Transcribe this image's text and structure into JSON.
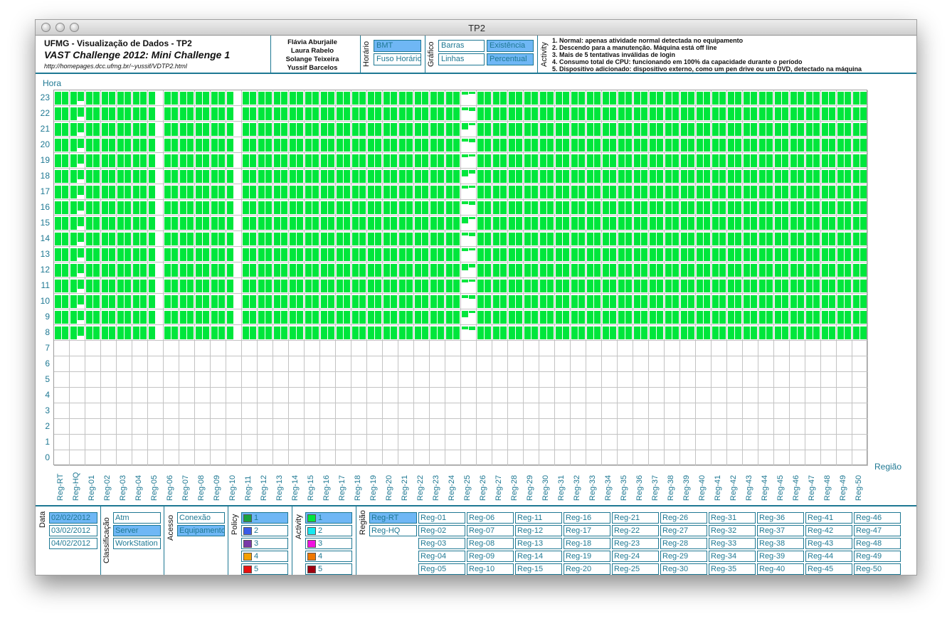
{
  "window": {
    "title": "TP2"
  },
  "header": {
    "line1": "UFMG - Visualização de Dados - TP2",
    "line2": "VAST Challenge 2012: Mini Challenge 1",
    "url": "http://homepages.dcc.ufmg.br/~yussif/VDTP2.html",
    "authors": [
      "Flávia Aburjaile",
      "Laura Rabelo",
      "Solange Teixeira",
      "Yussif Barcelos"
    ],
    "horario": {
      "label": "Horário",
      "options": [
        "BMT",
        "Fuso Horário"
      ],
      "selected": 0
    },
    "grafico": {
      "label": "Gráfico",
      "options": [
        "Barras",
        "Existência",
        "Linhas",
        "Percentual"
      ],
      "selected": [
        1,
        3
      ]
    },
    "activity_legend": {
      "label": "Activity",
      "lines": [
        "1. Normal: apenas atividade normal detectada no equipamento",
        "2. Descendo para a manutenção. Máquina está off line",
        "3. Mais de 5 tentativas inválidas de login",
        "4. Consumo total de CPU: funcionando em 100% da capacidade durante o período",
        "5. Dispositivo adicionado: dispositivo externo, como um pen drive ou um DVD, detectado na máquina"
      ]
    }
  },
  "chart": {
    "y_axis_label": "Hora",
    "x_axis_label": "Região",
    "hours": [
      "0",
      "1",
      "2",
      "3",
      "4",
      "5",
      "6",
      "7",
      "8",
      "9",
      "10",
      "11",
      "12",
      "13",
      "14",
      "15",
      "16",
      "17",
      "18",
      "19",
      "20",
      "21",
      "22",
      "23"
    ],
    "regions": [
      "Reg-RT",
      "Reg-HQ",
      "Reg-01",
      "Reg-02",
      "Reg-03",
      "Reg-04",
      "Reg-05",
      "Reg-06",
      "Reg-07",
      "Reg-08",
      "Reg-09",
      "Reg-10",
      "Reg-11",
      "Reg-12",
      "Reg-13",
      "Reg-14",
      "Reg-15",
      "Reg-16",
      "Reg-17",
      "Reg-18",
      "Reg-19",
      "Reg-20",
      "Reg-21",
      "Reg-22",
      "Reg-23",
      "Reg-24",
      "Reg-25",
      "Reg-26",
      "Reg-27",
      "Reg-28",
      "Reg-29",
      "Reg-30",
      "Reg-31",
      "Reg-32",
      "Reg-33",
      "Reg-34",
      "Reg-35",
      "Reg-36",
      "Reg-37",
      "Reg-38",
      "Reg-39",
      "Reg-40",
      "Reg-41",
      "Reg-42",
      "Reg-43",
      "Reg-44",
      "Reg-45",
      "Reg-46",
      "Reg-47",
      "Reg-48",
      "Reg-49",
      "Reg-50"
    ],
    "bar_color": "#00e63c",
    "active_hours": [
      8,
      23
    ]
  },
  "footer": {
    "data": {
      "label": "Data",
      "options": [
        "02/02/2012",
        "03/02/2012",
        "04/02/2012"
      ],
      "selected": 0
    },
    "classificacao": {
      "label": "Classificação",
      "options": [
        "Atm",
        "Server",
        "WorkStation"
      ],
      "selected": 1
    },
    "acesso": {
      "label": "Acesso",
      "options": [
        "Conexão",
        "Equipamento"
      ],
      "selected": 1
    },
    "policy": {
      "label": "Policy",
      "items": [
        {
          "label": "1",
          "color": "#1aa33e"
        },
        {
          "label": "2",
          "color": "#3b5ee8"
        },
        {
          "label": "3",
          "color": "#7a3aa8"
        },
        {
          "label": "4",
          "color": "#f5a000"
        },
        {
          "label": "5",
          "color": "#e81010"
        }
      ],
      "selected": 0
    },
    "activity": {
      "label": "Activity",
      "items": [
        {
          "label": "1",
          "color": "#00e63c"
        },
        {
          "label": "2",
          "color": "#18e8f0"
        },
        {
          "label": "3",
          "color": "#f010e0"
        },
        {
          "label": "4",
          "color": "#f07800"
        },
        {
          "label": "5",
          "color": "#a00010"
        }
      ],
      "selected": 0
    },
    "regiao": {
      "label": "Região",
      "main": [
        "Reg-RT",
        "Reg-HQ"
      ],
      "selected": 0,
      "regs": [
        "Reg-01",
        "Reg-02",
        "Reg-03",
        "Reg-04",
        "Reg-05",
        "Reg-06",
        "Reg-07",
        "Reg-08",
        "Reg-09",
        "Reg-10",
        "Reg-11",
        "Reg-12",
        "Reg-13",
        "Reg-14",
        "Reg-15",
        "Reg-16",
        "Reg-17",
        "Reg-18",
        "Reg-19",
        "Reg-20",
        "Reg-21",
        "Reg-22",
        "Reg-23",
        "Reg-24",
        "Reg-25",
        "Reg-26",
        "Reg-27",
        "Reg-28",
        "Reg-29",
        "Reg-30",
        "Reg-31",
        "Reg-32",
        "Reg-33",
        "Reg-34",
        "Reg-35",
        "Reg-36",
        "Reg-37",
        "Reg-38",
        "Reg-39",
        "Reg-40",
        "Reg-41",
        "Reg-42",
        "Reg-43",
        "Reg-44",
        "Reg-45",
        "Reg-46",
        "Reg-47",
        "Reg-48",
        "Reg-49",
        "Reg-50"
      ]
    }
  }
}
